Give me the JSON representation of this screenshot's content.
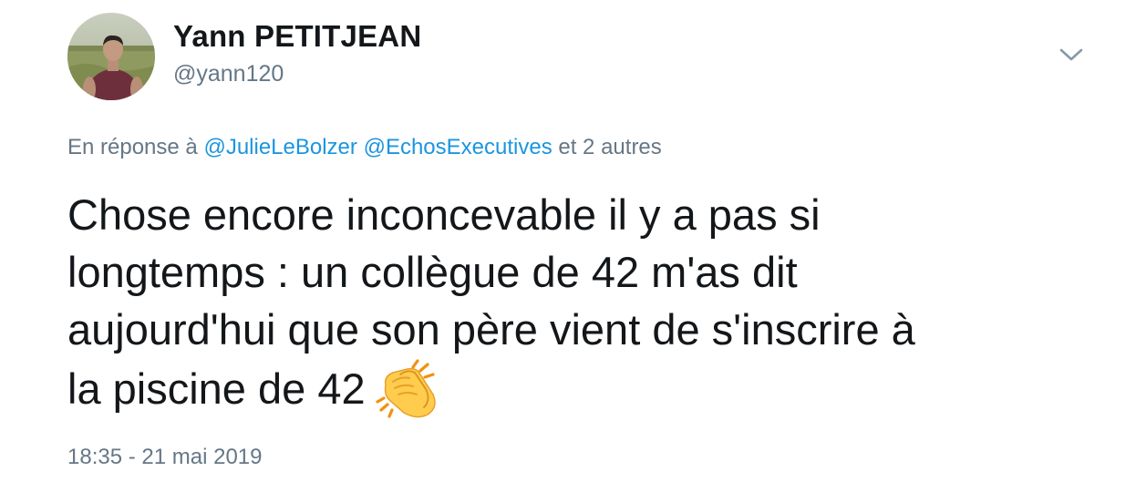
{
  "author": {
    "display_name": "Yann PETITJEAN",
    "handle": "@yann120"
  },
  "menu": {
    "icon": "chevron-down-icon"
  },
  "reply": {
    "prefix": "En réponse à",
    "mention_1": "@JulieLeBolzer",
    "mention_2": "@EchosExecutives",
    "suffix": "et 2 autres"
  },
  "tweet": {
    "line_1": "Chose encore inconcevable il y a pas si",
    "line_2": "longtemps : un collègue de 42 m'as dit",
    "line_3": "aujourd'hui que son père vient de s'inscrire à",
    "line_4": "la piscine de 42",
    "emoji": "clapping-hands-icon"
  },
  "meta": {
    "timestamp": "18:35 - 21 mai 2019"
  },
  "colors": {
    "text": "#14171a",
    "secondary": "#657786",
    "link": "#1b95e0"
  }
}
